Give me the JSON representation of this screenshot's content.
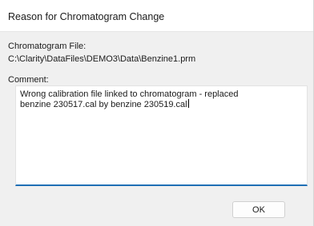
{
  "window": {
    "title": "Reason for Chromatogram Change"
  },
  "form": {
    "file_label": "Chromatogram File:",
    "file_path": "C:\\Clarity\\DataFiles\\DEMO3\\Data\\Benzine1.prm",
    "comment_label": "Comment:",
    "comment_value": "Wrong calibration file linked to chromatogram - replaced\nbenzine 230517.cal by benzine 230519.cal"
  },
  "buttons": {
    "ok_label": "OK"
  },
  "colors": {
    "focus_accent": "#1f6fb5",
    "dialog_background": "#f0f0f0"
  }
}
